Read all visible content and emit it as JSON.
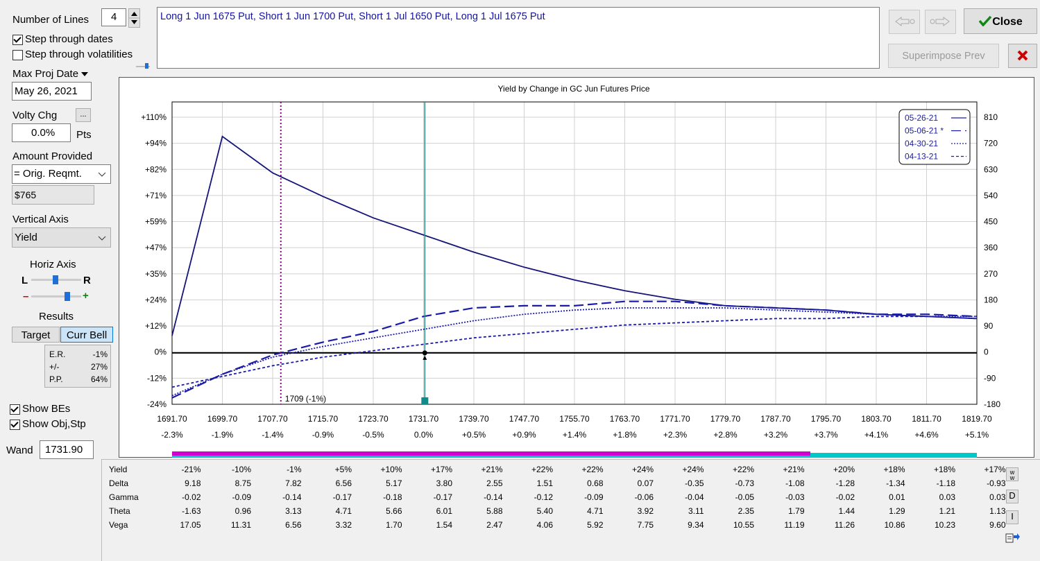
{
  "top": {
    "num_lines_label": "Number of Lines",
    "num_lines_value": "4",
    "step_dates_label": "Step through dates",
    "step_dates_checked": true,
    "step_vols_label": "Step through volatilities",
    "step_vols_checked": false,
    "strategy_text": "Long 1 Jun 1675 Put, Short 1 Jun 1700 Put, Short 1 Jul 1650 Put, Long 1 Jul 1675 Put",
    "close_label": "Close",
    "superimpose_label": "Superimpose Prev"
  },
  "left": {
    "max_proj_date_label": "Max Proj Date",
    "max_proj_date_value": "May 26, 2021",
    "volty_chg_label": "Volty Chg",
    "volty_dots": "...",
    "volty_value": "0.0%",
    "volty_unit": "Pts",
    "amount_label": "Amount Provided",
    "amount_select": "= Orig. Reqmt.",
    "amount_value": "$765",
    "vertical_axis_label": "Vertical Axis",
    "vertical_axis_value": "Yield",
    "horiz_axis_label": "Horiz Axis",
    "horiz_left": "L",
    "horiz_right": "R",
    "minus_sign": "–",
    "plus_sign": "+",
    "results_label": "Results",
    "target_label": "Target",
    "curr_bell_label": "Curr Bell",
    "stats": [
      {
        "label": "E.R.",
        "value": "-1%"
      },
      {
        "label": "+/-",
        "value": "27%"
      },
      {
        "label": "P.P.",
        "value": "64%"
      }
    ],
    "show_bes_label": "Show BEs",
    "show_bes_checked": true,
    "show_obj_label": "Show Obj,Stp",
    "show_obj_checked": true,
    "wand_label": "Wand",
    "wand_value": "1731.90"
  },
  "chart_data": {
    "type": "line",
    "title": "Yield by Change in GC Jun Futures Price",
    "xlabel": "",
    "ylabel": "",
    "x_ticks": [
      "1691.70",
      "1699.70",
      "1707.70",
      "1715.70",
      "1723.70",
      "1731.70",
      "1739.70",
      "1747.70",
      "1755.70",
      "1763.70",
      "1771.70",
      "1779.70",
      "1787.70",
      "1795.70",
      "1803.70",
      "1811.70",
      "1819.70"
    ],
    "x_pct_ticks": [
      "-2.3%",
      "-1.9%",
      "-1.4%",
      "-0.9%",
      "-0.5%",
      "0.0%",
      "+0.5%",
      "+0.9%",
      "+1.4%",
      "+1.8%",
      "+2.3%",
      "+2.8%",
      "+3.2%",
      "+3.7%",
      "+4.1%",
      "+4.6%",
      "+5.1%"
    ],
    "y_left_ticks": [
      "+110%",
      "+94%",
      "+82%",
      "+71%",
      "+59%",
      "+47%",
      "+35%",
      "+24%",
      "+12%",
      "0%",
      "-12%",
      "-24%"
    ],
    "y_right_ticks": [
      "810",
      "720",
      "630",
      "540",
      "450",
      "360",
      "270",
      "180",
      "90",
      "0",
      "-90",
      "-180"
    ],
    "ylim_left": [
      -24,
      110
    ],
    "ylim_right": [
      -180,
      810
    ],
    "xlim": [
      1691.7,
      1819.7
    ],
    "be_marker": {
      "x": 1709,
      "label": "1709 (-1%)"
    },
    "current_price_x": 1731.9,
    "legend_position": "top-right",
    "series": [
      {
        "name": "05-26-21",
        "style": "solid",
        "x": [
          1691.7,
          1699.7,
          1707.7,
          1715.7,
          1723.7,
          1731.7,
          1739.7,
          1747.7,
          1755.7,
          1763.7,
          1771.7,
          1779.7,
          1787.7,
          1795.7,
          1803.7,
          1811.7,
          1819.7
        ],
        "y": [
          8,
          101,
          84,
          73,
          63,
          55,
          47,
          40,
          34,
          29,
          25,
          22,
          21,
          20,
          18,
          17,
          16
        ]
      },
      {
        "name": "05-06-21 *",
        "style": "long-dash",
        "x": [
          1691.7,
          1699.7,
          1707.7,
          1715.7,
          1723.7,
          1731.7,
          1739.7,
          1747.7,
          1755.7,
          1763.7,
          1771.7,
          1779.7,
          1787.7,
          1795.7,
          1803.7,
          1811.7,
          1819.7
        ],
        "y": [
          -21,
          -10,
          -1,
          5,
          10,
          17,
          21,
          22,
          22,
          24,
          24,
          22,
          21,
          20,
          18,
          18,
          17
        ]
      },
      {
        "name": "04-30-21",
        "style": "dotted",
        "x": [
          1691.7,
          1699.7,
          1707.7,
          1715.7,
          1723.7,
          1731.7,
          1739.7,
          1747.7,
          1755.7,
          1763.7,
          1771.7,
          1779.7,
          1787.7,
          1795.7,
          1803.7,
          1811.7,
          1819.7
        ],
        "y": [
          -20,
          -10,
          -2,
          3,
          7,
          11,
          15,
          18,
          20,
          21,
          21,
          21,
          20,
          19,
          18,
          17,
          17
        ]
      },
      {
        "name": "04-13-21",
        "style": "short-dash",
        "x": [
          1691.7,
          1699.7,
          1707.7,
          1715.7,
          1723.7,
          1731.7,
          1739.7,
          1747.7,
          1755.7,
          1763.7,
          1771.7,
          1779.7,
          1787.7,
          1795.7,
          1803.7,
          1811.7,
          1819.7
        ],
        "y": [
          -16,
          -11,
          -6,
          -2,
          1,
          4,
          7,
          9,
          11,
          13,
          14,
          15,
          16,
          16,
          17,
          17,
          16
        ]
      }
    ]
  },
  "greeks": {
    "rows": [
      {
        "label": "Yield",
        "values": [
          "-21%",
          "-10%",
          "-1%",
          "+5%",
          "+10%",
          "+17%",
          "+21%",
          "+22%",
          "+22%",
          "+24%",
          "+24%",
          "+22%",
          "+21%",
          "+20%",
          "+18%",
          "+18%",
          "+17%"
        ]
      },
      {
        "label": "Delta",
        "values": [
          "9.18",
          "8.75",
          "7.82",
          "6.56",
          "5.17",
          "3.80",
          "2.55",
          "1.51",
          "0.68",
          "0.07",
          "-0.35",
          "-0.73",
          "-1.08",
          "-1.28",
          "-1.34",
          "-1.18",
          "-0.93"
        ]
      },
      {
        "label": "Gamma",
        "values": [
          "-0.02",
          "-0.09",
          "-0.14",
          "-0.17",
          "-0.18",
          "-0.17",
          "-0.14",
          "-0.12",
          "-0.09",
          "-0.06",
          "-0.04",
          "-0.05",
          "-0.03",
          "-0.02",
          "0.01",
          "0.03",
          "0.03"
        ]
      },
      {
        "label": "Theta",
        "values": [
          "-1.63",
          "0.96",
          "3.13",
          "4.71",
          "5.66",
          "6.01",
          "5.88",
          "5.40",
          "4.71",
          "3.92",
          "3.11",
          "2.35",
          "1.79",
          "1.44",
          "1.29",
          "1.21",
          "1.13"
        ]
      },
      {
        "label": "Vega",
        "values": [
          "17.05",
          "11.31",
          "6.56",
          "3.32",
          "1.70",
          "1.54",
          "2.47",
          "4.06",
          "5.92",
          "7.75",
          "9.34",
          "10.55",
          "11.19",
          "11.26",
          "10.86",
          "10.23",
          "9.60"
        ]
      }
    ],
    "side_buttons": [
      "w",
      "D",
      "I"
    ]
  },
  "colors": {
    "series": "#1a1aa8",
    "series_dark": "#14147a",
    "be_line": "#8b008b",
    "current_line": "#2e8b8b",
    "magenta_bar": "#d000d0",
    "cyan_bar": "#00c8c8"
  }
}
